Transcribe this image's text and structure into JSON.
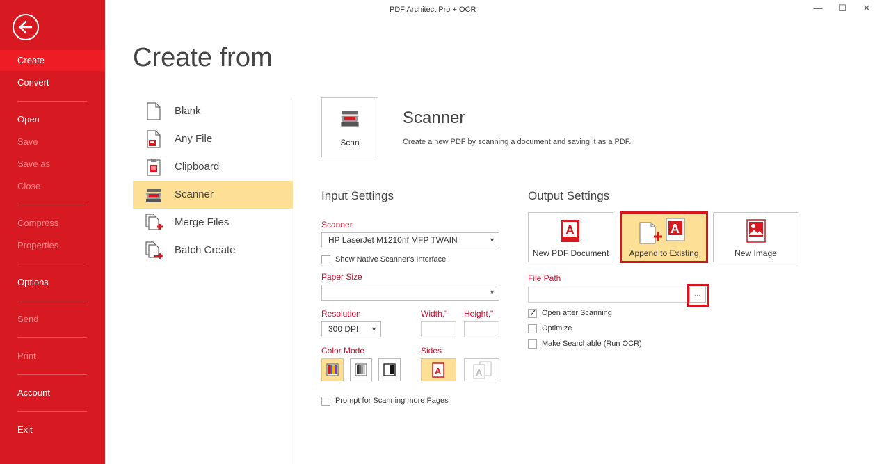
{
  "window": {
    "title": "PDF Architect Pro + OCR",
    "minimize": "—",
    "maximize": "☐",
    "close": "✕"
  },
  "sidebar": {
    "back_icon": "back-arrow-icon",
    "items": [
      {
        "label": "Create",
        "active": true,
        "enabled": true
      },
      {
        "label": "Convert",
        "enabled": true
      },
      {
        "label": "Open",
        "enabled": true
      },
      {
        "label": "Save",
        "enabled": false
      },
      {
        "label": "Save as",
        "enabled": false
      },
      {
        "label": "Close",
        "enabled": false
      },
      {
        "label": "Compress",
        "enabled": false
      },
      {
        "label": "Properties",
        "enabled": false
      },
      {
        "label": "Options",
        "enabled": true
      },
      {
        "label": "Send",
        "enabled": false
      },
      {
        "label": "Print",
        "enabled": false
      },
      {
        "label": "Account",
        "enabled": true
      },
      {
        "label": "Exit",
        "enabled": true
      }
    ]
  },
  "page": {
    "title": "Create from"
  },
  "create_list": [
    {
      "label": "Blank",
      "icon": "blank-page-icon"
    },
    {
      "label": "Any File",
      "icon": "any-file-icon"
    },
    {
      "label": "Clipboard",
      "icon": "clipboard-icon"
    },
    {
      "label": "Scanner",
      "icon": "scanner-icon",
      "selected": true
    },
    {
      "label": "Merge Files",
      "icon": "merge-files-icon"
    },
    {
      "label": "Batch Create",
      "icon": "batch-create-icon"
    }
  ],
  "scanner": {
    "scan_button": "Scan",
    "title": "Scanner",
    "description": "Create a new PDF by scanning a document and saving it as a PDF."
  },
  "input_settings": {
    "title": "Input Settings",
    "scanner_label": "Scanner",
    "scanner_value": "HP LaserJet M1210nf MFP TWAIN",
    "native_interface": "Show Native Scanner's Interface",
    "paper_size_label": "Paper Size",
    "paper_size_value": "",
    "resolution_label": "Resolution",
    "resolution_value": "300 DPI",
    "width_label": "Width,\"",
    "height_label": "Height,\"",
    "color_mode_label": "Color Mode",
    "color_modes": [
      "color-mode-icon",
      "grayscale-mode-icon",
      "black-white-mode-icon"
    ],
    "sides_label": "Sides",
    "sides": [
      "single-side-icon",
      "double-side-icon"
    ],
    "prompt_more": "Prompt for Scanning more Pages"
  },
  "output_settings": {
    "title": "Output Settings",
    "options": [
      {
        "label": "New PDF Document",
        "icon": "new-pdf-icon"
      },
      {
        "label": "Append to Existing",
        "icon": "append-pdf-icon",
        "selected": true
      },
      {
        "label": "New Image",
        "icon": "new-image-icon"
      }
    ],
    "file_path_label": "File Path",
    "file_path_value": "",
    "browse_label": "...",
    "open_after": "Open after Scanning",
    "open_after_checked": true,
    "optimize": "Optimize",
    "make_searchable": "Make Searchable (Run OCR)"
  },
  "colors": {
    "sidebar": "#d71921",
    "active": "#ee1c25",
    "highlight": "#fddf95",
    "accent": "#c8102e"
  }
}
